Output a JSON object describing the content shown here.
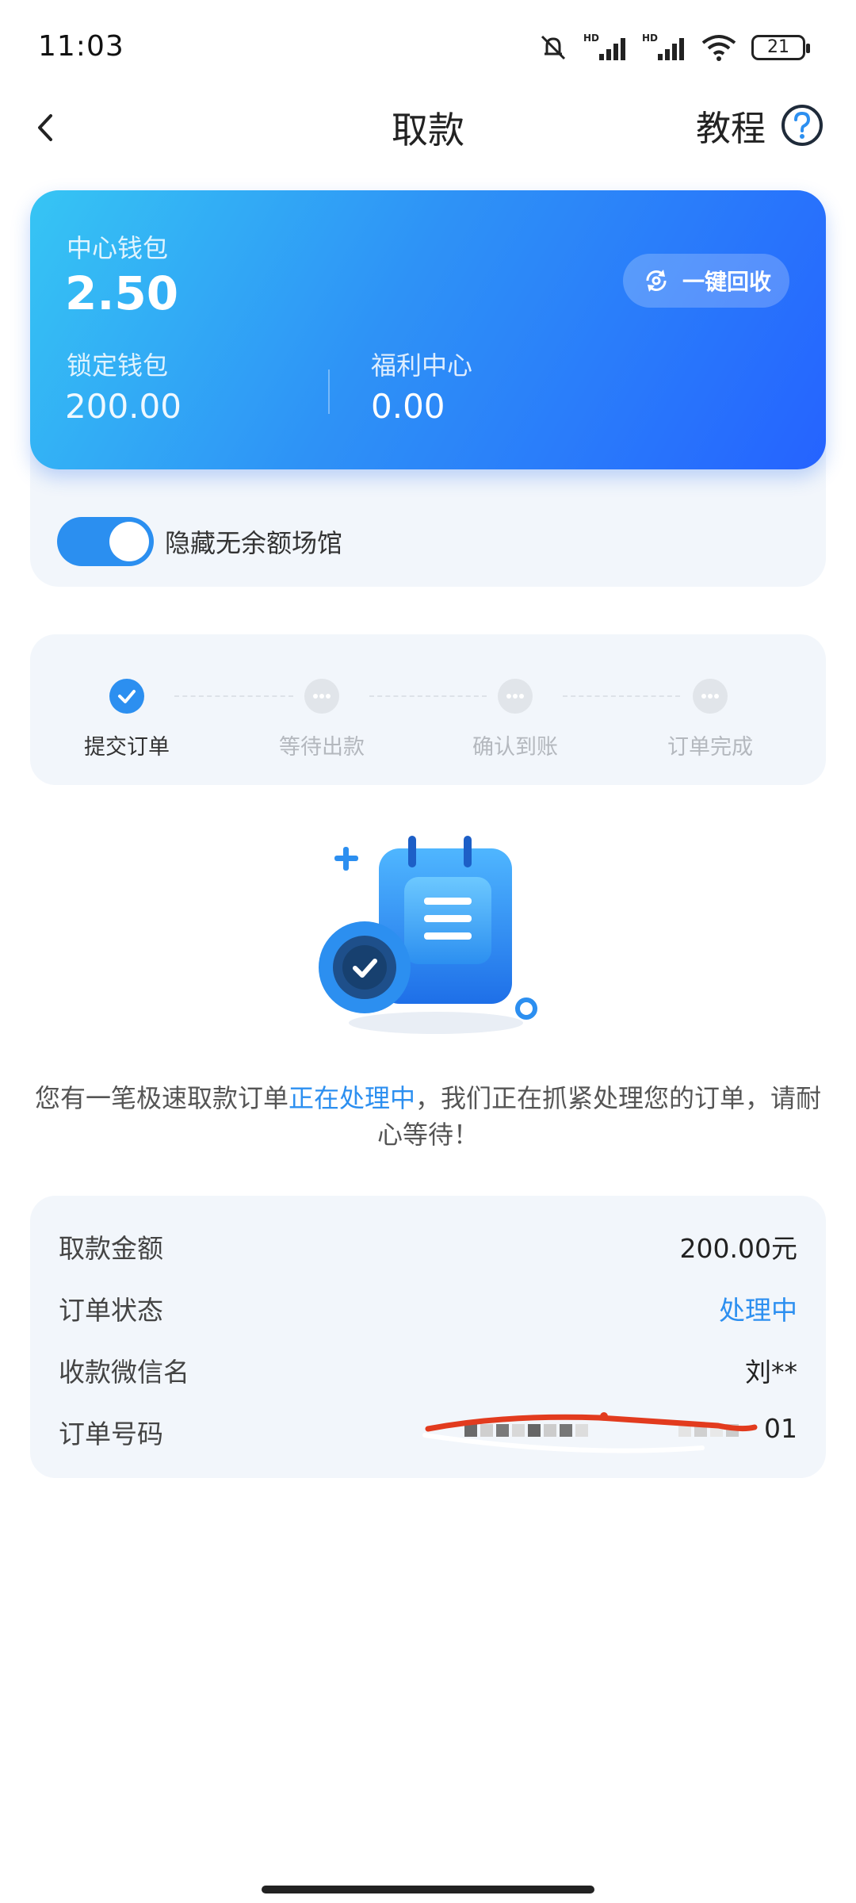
{
  "status_bar": {
    "time": "11:03",
    "battery": "21"
  },
  "nav": {
    "title": "取款",
    "tutorial": "教程"
  },
  "wallet": {
    "center_label": "中心钱包",
    "center_value": "2.50",
    "recycle_label": "一键回收",
    "locked_label": "锁定钱包",
    "locked_value": "200.00",
    "welfare_label": "福利中心",
    "welfare_value": "0.00",
    "toggle_on": true,
    "toggle_label": "隐藏无余额场馆"
  },
  "steps": [
    {
      "label": "提交订单",
      "state": "done"
    },
    {
      "label": "等待出款",
      "state": "pending"
    },
    {
      "label": "确认到账",
      "state": "pending"
    },
    {
      "label": "订单完成",
      "state": "pending"
    }
  ],
  "message": {
    "before": "您有一笔极速取款订单",
    "highlight": "正在处理中",
    "after": "，我们正在抓紧处理您的订单，请耐心等待！"
  },
  "details": {
    "amount_label": "取款金额",
    "amount_value": "200.00元",
    "status_label": "订单状态",
    "status_value": "处理中",
    "name_label": "收款微信名",
    "name_value": "刘**",
    "order_label": "订单号码",
    "order_value_suffix": "01"
  },
  "colors": {
    "accent": "#2c8ff0",
    "card_start": "#36c5f4",
    "card_end": "#2563ff",
    "panel_bg": "#f2f6fb"
  }
}
